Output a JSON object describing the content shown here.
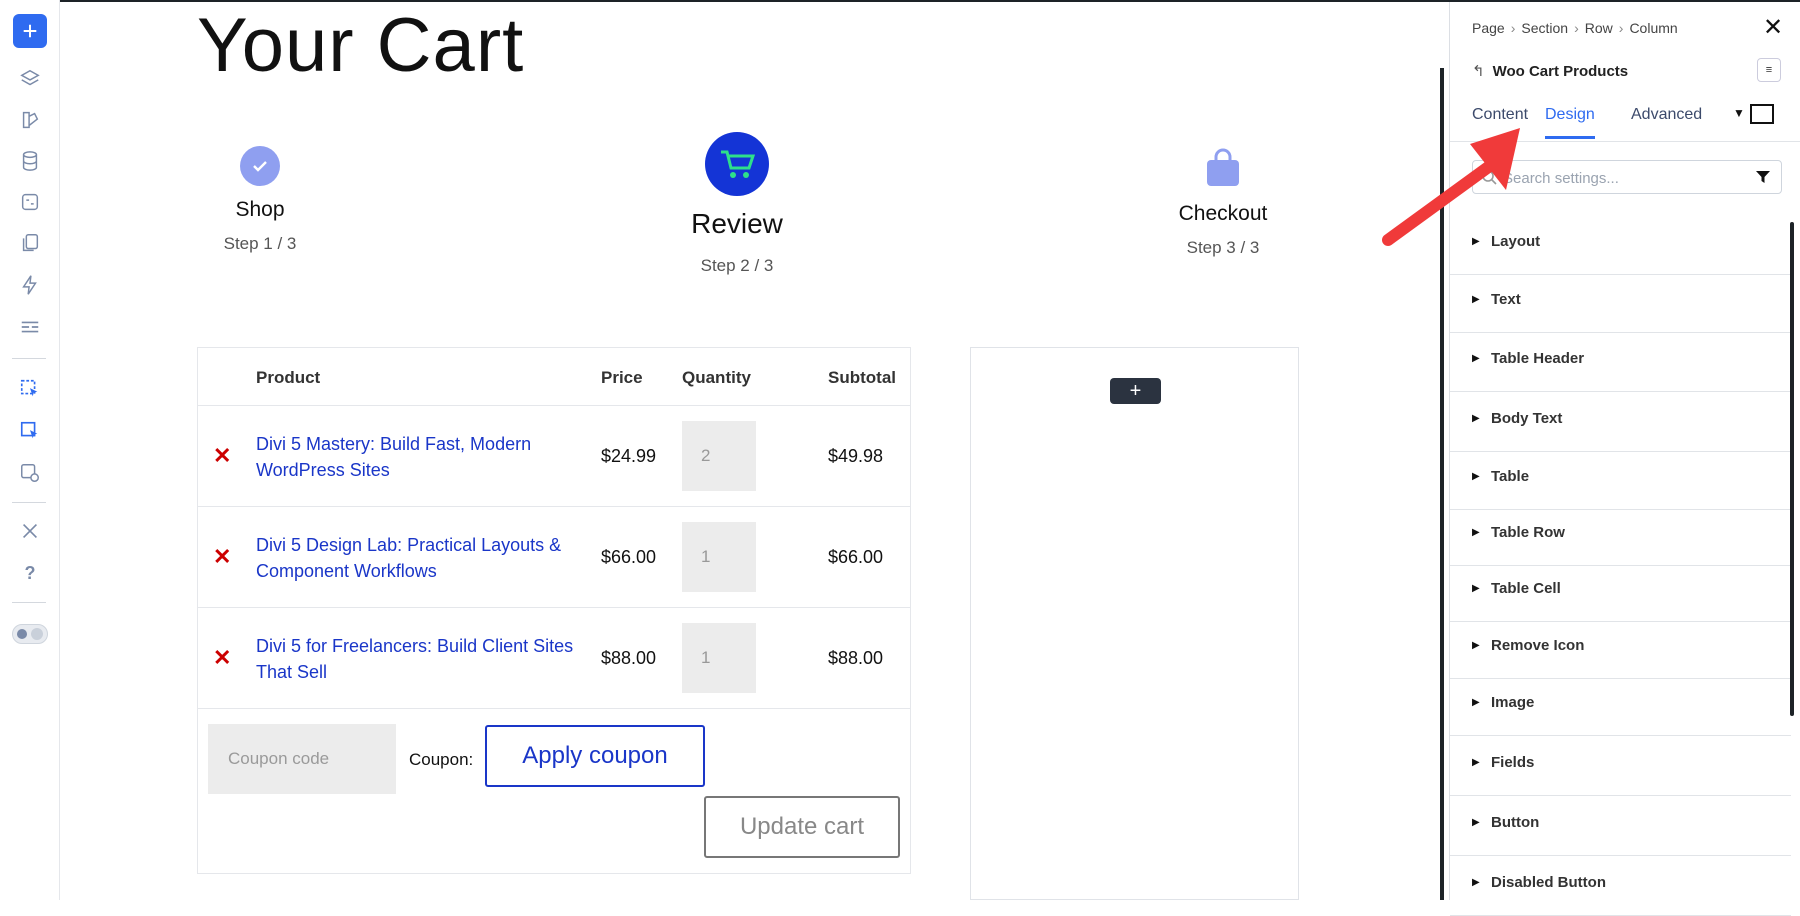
{
  "page": {
    "title": "Your Cart"
  },
  "steps": [
    {
      "label": "Shop",
      "sub": "Step 1 / 3",
      "icon": "check-icon"
    },
    {
      "label": "Review",
      "sub": "Step 2 / 3",
      "icon": "cart-icon"
    },
    {
      "label": "Checkout",
      "sub": "Step 3 / 3",
      "icon": "bag-icon"
    }
  ],
  "cart": {
    "headers": {
      "product": "Product",
      "price": "Price",
      "quantity": "Quantity",
      "subtotal": "Subtotal"
    },
    "items": [
      {
        "name": "Divi 5 Mastery: Build Fast, Modern WordPress Sites",
        "price": "$24.99",
        "qty": "2",
        "subtotal": "$49.98"
      },
      {
        "name": "Divi 5 Design Lab: Practical Layouts & Component Workflows",
        "price": "$66.00",
        "qty": "1",
        "subtotal": "$66.00"
      },
      {
        "name": "Divi 5 for Freelancers: Build Client Sites That Sell",
        "price": "$88.00",
        "qty": "1",
        "subtotal": "$88.00"
      }
    ],
    "coupon_placeholder": "Coupon code",
    "coupon_label": "Coupon:",
    "apply_label": "Apply coupon",
    "update_label": "Update cart"
  },
  "empty_column": {
    "add_label": "+"
  },
  "panel": {
    "breadcrumb": [
      "Page",
      "Section",
      "Row",
      "Column"
    ],
    "close_label": "✕",
    "module_title": "Woo Cart Products",
    "tabs": [
      {
        "label": "Content",
        "active": false
      },
      {
        "label": "Design",
        "active": true
      },
      {
        "label": "Advanced",
        "active": false
      }
    ],
    "search_placeholder": "Search settings...",
    "groups": [
      "Layout",
      "Text",
      "Table Header",
      "Body Text",
      "Table",
      "Table Row",
      "Table Cell",
      "Remove Icon",
      "Image",
      "Fields",
      "Button",
      "Disabled Button"
    ]
  },
  "colors": {
    "accent": "#2f6bf0",
    "link": "#1a36c8",
    "remove": "#cc0000",
    "step_active": "#1434d6",
    "step_done": "#8f9ff0",
    "arrow": "#f03a3a"
  }
}
